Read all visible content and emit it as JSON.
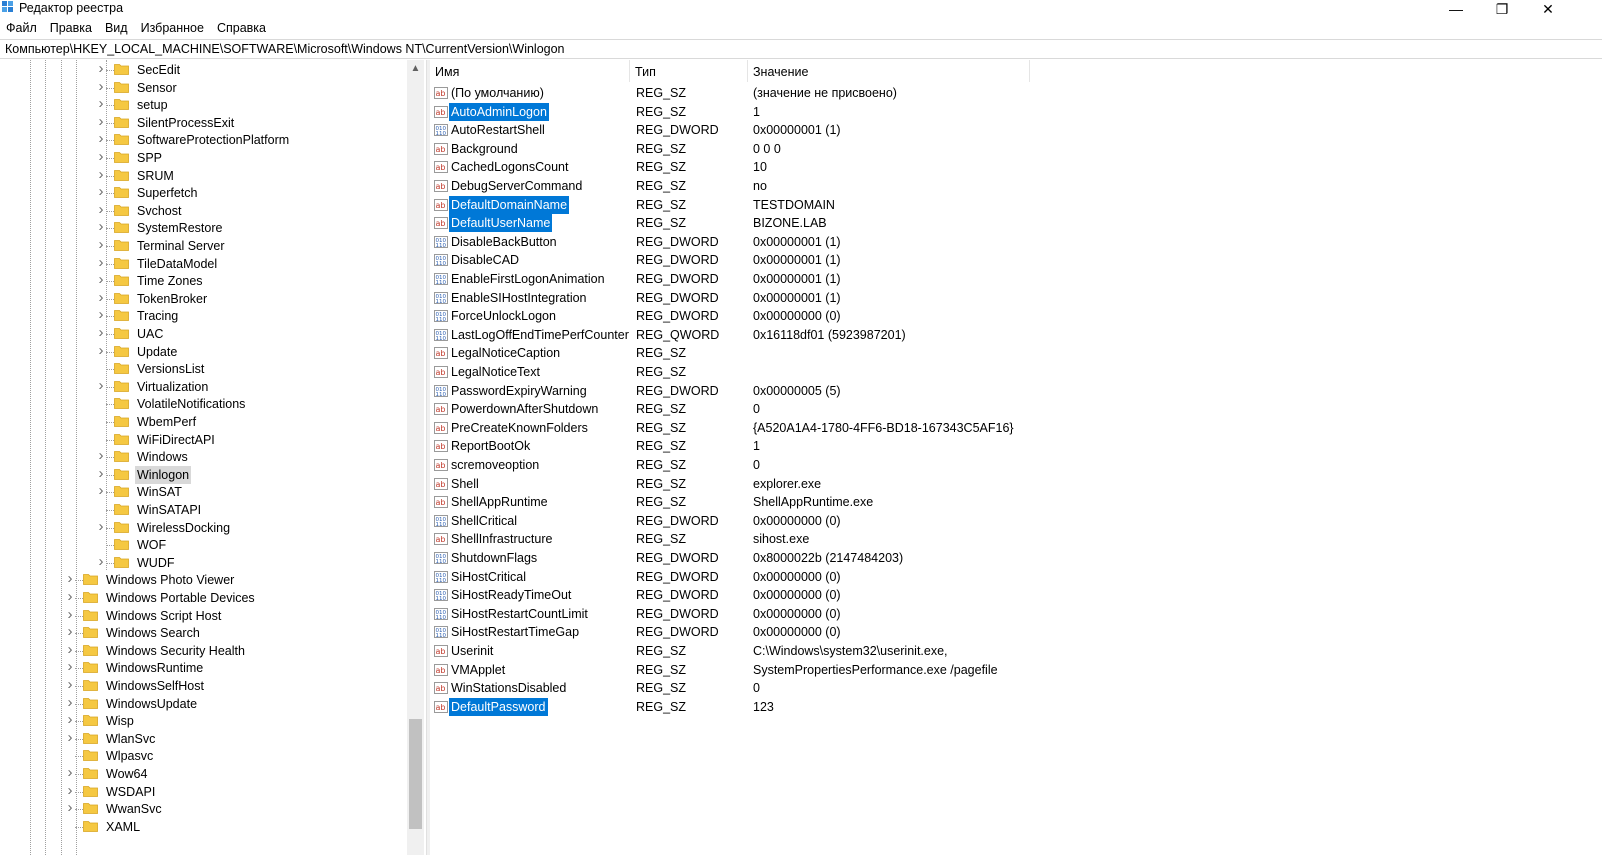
{
  "window": {
    "title": "Редактор реестра",
    "minimize": "—",
    "restore": "❐",
    "close": "✕"
  },
  "menu": [
    "Файл",
    "Правка",
    "Вид",
    "Избранное",
    "Справка"
  ],
  "address": "Компьютер\\HKEY_LOCAL_MACHINE\\SOFTWARE\\Microsoft\\Windows NT\\CurrentVersion\\Winlogon",
  "tree": {
    "children": [
      {
        "label": "SecEdit",
        "expander": true
      },
      {
        "label": "Sensor",
        "expander": true
      },
      {
        "label": "setup",
        "expander": true
      },
      {
        "label": "SilentProcessExit",
        "expander": true
      },
      {
        "label": "SoftwareProtectionPlatform",
        "expander": true
      },
      {
        "label": "SPP",
        "expander": true
      },
      {
        "label": "SRUM",
        "expander": true
      },
      {
        "label": "Superfetch",
        "expander": true
      },
      {
        "label": "Svchost",
        "expander": true
      },
      {
        "label": "SystemRestore",
        "expander": true
      },
      {
        "label": "Terminal Server",
        "expander": true
      },
      {
        "label": "TileDataModel",
        "expander": true
      },
      {
        "label": "Time Zones",
        "expander": true
      },
      {
        "label": "TokenBroker",
        "expander": true
      },
      {
        "label": "Tracing",
        "expander": true
      },
      {
        "label": "UAC",
        "expander": true
      },
      {
        "label": "Update",
        "expander": true
      },
      {
        "label": "VersionsList",
        "expander": false
      },
      {
        "label": "Virtualization",
        "expander": true
      },
      {
        "label": "VolatileNotifications",
        "expander": false
      },
      {
        "label": "WbemPerf",
        "expander": false
      },
      {
        "label": "WiFiDirectAPI",
        "expander": false
      },
      {
        "label": "Windows",
        "expander": true
      },
      {
        "label": "Winlogon",
        "expander": true,
        "selected": true
      },
      {
        "label": "WinSAT",
        "expander": true
      },
      {
        "label": "WinSATAPI",
        "expander": false
      },
      {
        "label": "WirelessDocking",
        "expander": true
      },
      {
        "label": "WOF",
        "expander": false
      },
      {
        "label": "WUDF",
        "expander": true
      }
    ],
    "siblings": [
      {
        "label": "Windows Photo Viewer",
        "expander": true
      },
      {
        "label": "Windows Portable Devices",
        "expander": true
      },
      {
        "label": "Windows Script Host",
        "expander": true
      },
      {
        "label": "Windows Search",
        "expander": true
      },
      {
        "label": "Windows Security Health",
        "expander": true
      },
      {
        "label": "WindowsRuntime",
        "expander": true
      },
      {
        "label": "WindowsSelfHost",
        "expander": true
      },
      {
        "label": "WindowsUpdate",
        "expander": true
      },
      {
        "label": "Wisp",
        "expander": true
      },
      {
        "label": "WlanSvc",
        "expander": true
      },
      {
        "label": "Wlpasvc",
        "expander": false
      },
      {
        "label": "Wow64",
        "expander": true
      },
      {
        "label": "WSDAPI",
        "expander": true
      },
      {
        "label": "WwanSvc",
        "expander": true
      },
      {
        "label": "XAML",
        "expander": false
      }
    ]
  },
  "columns": {
    "name": "Имя",
    "type": "Тип",
    "data": "Значение"
  },
  "values": [
    {
      "icon": "sz",
      "name": "(По умолчанию)",
      "type": "REG_SZ",
      "data": "(значение не присвоено)"
    },
    {
      "icon": "sz",
      "name": "AutoAdminLogon",
      "type": "REG_SZ",
      "data": "1",
      "selected": true
    },
    {
      "icon": "dw",
      "name": "AutoRestartShell",
      "type": "REG_DWORD",
      "data": "0x00000001 (1)"
    },
    {
      "icon": "sz",
      "name": "Background",
      "type": "REG_SZ",
      "data": "0 0 0"
    },
    {
      "icon": "sz",
      "name": "CachedLogonsCount",
      "type": "REG_SZ",
      "data": "10"
    },
    {
      "icon": "sz",
      "name": "DebugServerCommand",
      "type": "REG_SZ",
      "data": "no"
    },
    {
      "icon": "sz",
      "name": "DefaultDomainName",
      "type": "REG_SZ",
      "data": "TESTDOMAIN",
      "selected": true
    },
    {
      "icon": "sz",
      "name": "DefaultUserName",
      "type": "REG_SZ",
      "data": "BIZONE.LAB",
      "selected": true
    },
    {
      "icon": "dw",
      "name": "DisableBackButton",
      "type": "REG_DWORD",
      "data": "0x00000001 (1)"
    },
    {
      "icon": "dw",
      "name": "DisableCAD",
      "type": "REG_DWORD",
      "data": "0x00000001 (1)"
    },
    {
      "icon": "dw",
      "name": "EnableFirstLogonAnimation",
      "type": "REG_DWORD",
      "data": "0x00000001 (1)"
    },
    {
      "icon": "dw",
      "name": "EnableSIHostIntegration",
      "type": "REG_DWORD",
      "data": "0x00000001 (1)"
    },
    {
      "icon": "dw",
      "name": "ForceUnlockLogon",
      "type": "REG_DWORD",
      "data": "0x00000000 (0)"
    },
    {
      "icon": "dw",
      "name": "LastLogOffEndTimePerfCounter",
      "type": "REG_QWORD",
      "data": "0x16118df01 (5923987201)"
    },
    {
      "icon": "sz",
      "name": "LegalNoticeCaption",
      "type": "REG_SZ",
      "data": ""
    },
    {
      "icon": "sz",
      "name": "LegalNoticeText",
      "type": "REG_SZ",
      "data": ""
    },
    {
      "icon": "dw",
      "name": "PasswordExpiryWarning",
      "type": "REG_DWORD",
      "data": "0x00000005 (5)"
    },
    {
      "icon": "sz",
      "name": "PowerdownAfterShutdown",
      "type": "REG_SZ",
      "data": "0"
    },
    {
      "icon": "sz",
      "name": "PreCreateKnownFolders",
      "type": "REG_SZ",
      "data": "{A520A1A4-1780-4FF6-BD18-167343C5AF16}"
    },
    {
      "icon": "sz",
      "name": "ReportBootOk",
      "type": "REG_SZ",
      "data": "1"
    },
    {
      "icon": "sz",
      "name": "scremoveoption",
      "type": "REG_SZ",
      "data": "0"
    },
    {
      "icon": "sz",
      "name": "Shell",
      "type": "REG_SZ",
      "data": "explorer.exe"
    },
    {
      "icon": "sz",
      "name": "ShellAppRuntime",
      "type": "REG_SZ",
      "data": "ShellAppRuntime.exe"
    },
    {
      "icon": "dw",
      "name": "ShellCritical",
      "type": "REG_DWORD",
      "data": "0x00000000 (0)"
    },
    {
      "icon": "sz",
      "name": "ShellInfrastructure",
      "type": "REG_SZ",
      "data": "sihost.exe"
    },
    {
      "icon": "dw",
      "name": "ShutdownFlags",
      "type": "REG_DWORD",
      "data": "0x8000022b (2147484203)"
    },
    {
      "icon": "dw",
      "name": "SiHostCritical",
      "type": "REG_DWORD",
      "data": "0x00000000 (0)"
    },
    {
      "icon": "dw",
      "name": "SiHostReadyTimeOut",
      "type": "REG_DWORD",
      "data": "0x00000000 (0)"
    },
    {
      "icon": "dw",
      "name": "SiHostRestartCountLimit",
      "type": "REG_DWORD",
      "data": "0x00000000 (0)"
    },
    {
      "icon": "dw",
      "name": "SiHostRestartTimeGap",
      "type": "REG_DWORD",
      "data": "0x00000000 (0)"
    },
    {
      "icon": "sz",
      "name": "Userinit",
      "type": "REG_SZ",
      "data": "C:\\Windows\\system32\\userinit.exe,"
    },
    {
      "icon": "sz",
      "name": "VMApplet",
      "type": "REG_SZ",
      "data": "SystemPropertiesPerformance.exe /pagefile"
    },
    {
      "icon": "sz",
      "name": "WinStationsDisabled",
      "type": "REG_SZ",
      "data": "0"
    },
    {
      "icon": "sz",
      "name": "DefaultPassword",
      "type": "REG_SZ",
      "data": "123",
      "selected": true
    }
  ],
  "colors": {
    "selection": "#0078d7",
    "folder": "#f5c842",
    "tree_selection": "#d9d9d9"
  }
}
